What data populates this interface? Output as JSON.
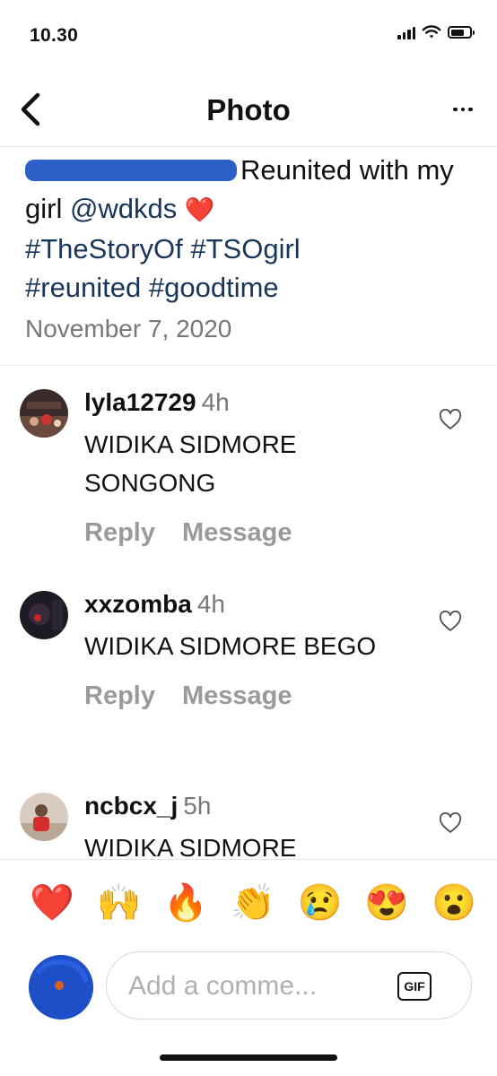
{
  "status_bar": {
    "time": "10.30"
  },
  "nav": {
    "title": "Photo"
  },
  "caption": {
    "text_before": "Reunited with my girl ",
    "mention": "@wdkds",
    "emoji": "❤️",
    "hashtags": [
      "#TheStoryOf",
      "#TSOgirl",
      "#reunited",
      "#goodtime"
    ],
    "date": "November 7, 2020"
  },
  "comments": [
    {
      "username": "lyla12729",
      "time": "4h",
      "text": "WIDIKA SIDMORE SONGONG",
      "reply_label": "Reply",
      "message_label": "Message"
    },
    {
      "username": "xxzomba",
      "time": "4h",
      "text": "WIDIKA SIDMORE BEGO",
      "reply_label": "Reply",
      "message_label": "Message"
    },
    {
      "username": "ncbcx_j",
      "time": "5h",
      "text": "WIDIKA SIDMORE"
    }
  ],
  "quick_reactions": [
    "❤️",
    "🙌",
    "🔥",
    "👏",
    "😢",
    "😍",
    "😮"
  ],
  "composer": {
    "placeholder": "Add a comme...",
    "gif_label": "GIF"
  },
  "colors": {
    "link": "#17365a",
    "secondary_text": "#777777",
    "action_text": "#9a9a9a",
    "redaction": "#2d5fc9"
  }
}
